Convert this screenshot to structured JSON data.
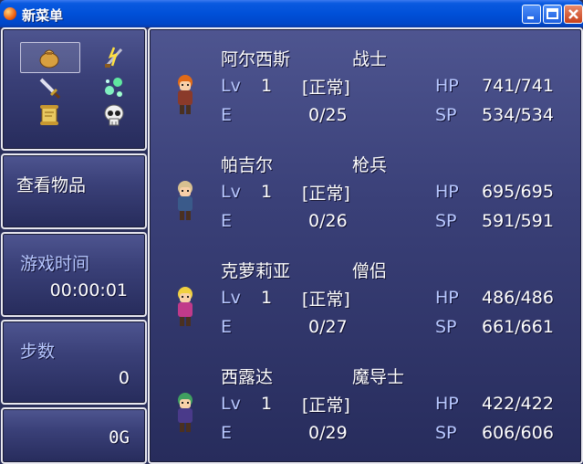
{
  "window": {
    "title": "新菜单"
  },
  "menu": {
    "icons": [
      "bag-icon",
      "skill-icon",
      "sword-icon",
      "status-icon",
      "scroll-icon",
      "skull-icon"
    ],
    "item_label": "查看物品"
  },
  "playtime": {
    "label": "游戏时间",
    "value": "00:00:01"
  },
  "steps": {
    "label": "步数",
    "value": "0"
  },
  "gold": {
    "value": "0G"
  },
  "party": [
    {
      "name": "阿尔西斯",
      "class": "战士",
      "lv_label": "Lv",
      "level": "1",
      "state": "[正常]",
      "e_label": "E",
      "exp": "0/25",
      "hp_label": "HP",
      "hp": "741/741",
      "sp_label": "SP",
      "sp": "534/534",
      "hair": "#e06a18",
      "body": "#8a3a2a"
    },
    {
      "name": "帕吉尔",
      "class": "枪兵",
      "lv_label": "Lv",
      "level": "1",
      "state": "[正常]",
      "e_label": "E",
      "exp": "0/26",
      "hp_label": "HP",
      "hp": "695/695",
      "sp_label": "SP",
      "sp": "591/591",
      "hair": "#d8c090",
      "body": "#3a5a8a"
    },
    {
      "name": "克萝莉亚",
      "class": "僧侣",
      "lv_label": "Lv",
      "level": "1",
      "state": "[正常]",
      "e_label": "E",
      "exp": "0/27",
      "hp_label": "HP",
      "hp": "486/486",
      "sp_label": "SP",
      "sp": "661/661",
      "hair": "#f0d040",
      "body": "#c03a8a"
    },
    {
      "name": "西露达",
      "class": "魔导士",
      "lv_label": "Lv",
      "level": "1",
      "state": "[正常]",
      "e_label": "E",
      "exp": "0/29",
      "hp_label": "HP",
      "hp": "422/422",
      "sp_label": "SP",
      "sp": "606/606",
      "hair": "#40a060",
      "body": "#4a3a8a"
    }
  ]
}
